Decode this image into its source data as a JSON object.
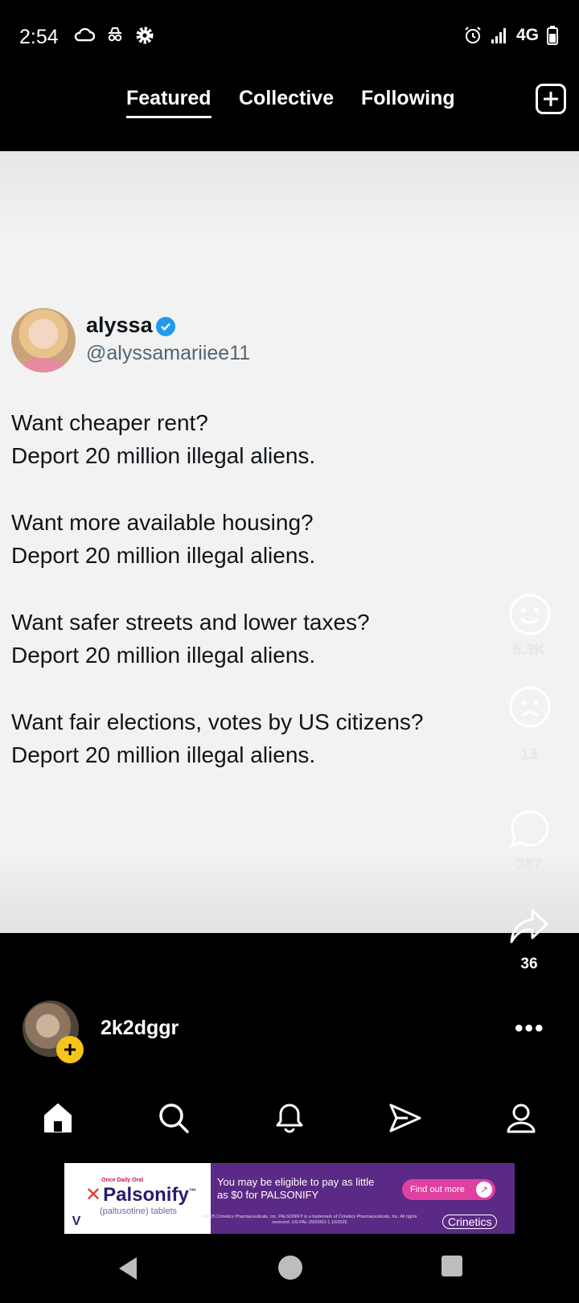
{
  "status_bar": {
    "time": "2:54",
    "network": "4G",
    "icons": [
      "cloud-icon",
      "incognito-icon",
      "settings-gear-icon",
      "alarm-icon",
      "signal-icon",
      "battery-icon"
    ]
  },
  "tabs": [
    {
      "label": "Featured",
      "active": true
    },
    {
      "label": "Collective",
      "active": false
    },
    {
      "label": "Following",
      "active": false
    }
  ],
  "post": {
    "author_name": "alyssa",
    "author_handle": "@alyssamariiee11",
    "verified": true,
    "lines": [
      "Want cheaper rent?",
      "Deport 20 million illegal aliens.",
      "Want more available housing?",
      "Deport 20 million illegal aliens.",
      "Want safer streets and lower taxes?",
      "Deport 20 million illegal aliens.",
      "Want fair elections, votes by US citizens?",
      "Deport 20 million illegal aliens."
    ]
  },
  "actions": {
    "like_count": "5.3K",
    "dislike_count": "13",
    "comment_count": "387",
    "share_count": "36"
  },
  "poster": {
    "username": "2k2dggr",
    "more_label": "•••",
    "follow_symbol": "+"
  },
  "ad": {
    "tagline": "Once Daily Oral",
    "brand": "Palsonify",
    "brand_mark": "™",
    "sub": "(paltusotine) tablets",
    "text": "You may be eligible to pay as little as $0 for PALSONIFY",
    "cta": "Find out more",
    "legal": "©2025 Crinetics Pharmaceuticals, Inc. PALSONIFY is a trademark of Crinetics Pharmaceuticals, Inc. All rights reserved. US-PAL-2500062-1 10/2025",
    "company": "Crinetics",
    "badge": "V"
  },
  "colors": {
    "background": "#000000",
    "post_bg": "#f2f2f2",
    "verified_blue": "#1d9bf0",
    "follow_yellow": "#f5c518",
    "ad_purple": "#5b2a86"
  }
}
